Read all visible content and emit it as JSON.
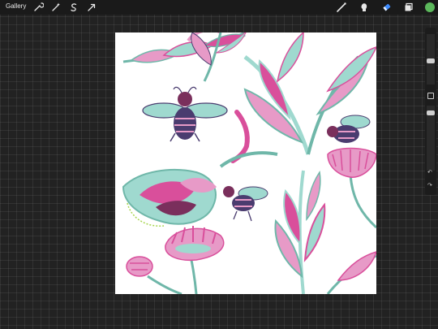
{
  "topbar": {
    "gallery_label": "Gallery",
    "left_tools": [
      "wrench-icon",
      "magic-wand-icon",
      "selection-icon",
      "transform-arrow-icon"
    ],
    "right_tools": [
      "brush-icon",
      "smudge-icon",
      "eraser-icon",
      "layers-icon"
    ],
    "active_tool": "eraser-icon",
    "active_color": "#5cb85c"
  },
  "sidebar": {
    "brush_size_level": 0.28,
    "opacity_level": 0.42,
    "undo_glyph": "↶",
    "redo_glyph": "↷"
  },
  "canvas": {
    "background": "#ffffff",
    "palette": [
      "#d94f9b",
      "#e79ac7",
      "#9fd9cf",
      "#6fb7a9",
      "#4a3c6f",
      "#7a2f5c"
    ]
  }
}
